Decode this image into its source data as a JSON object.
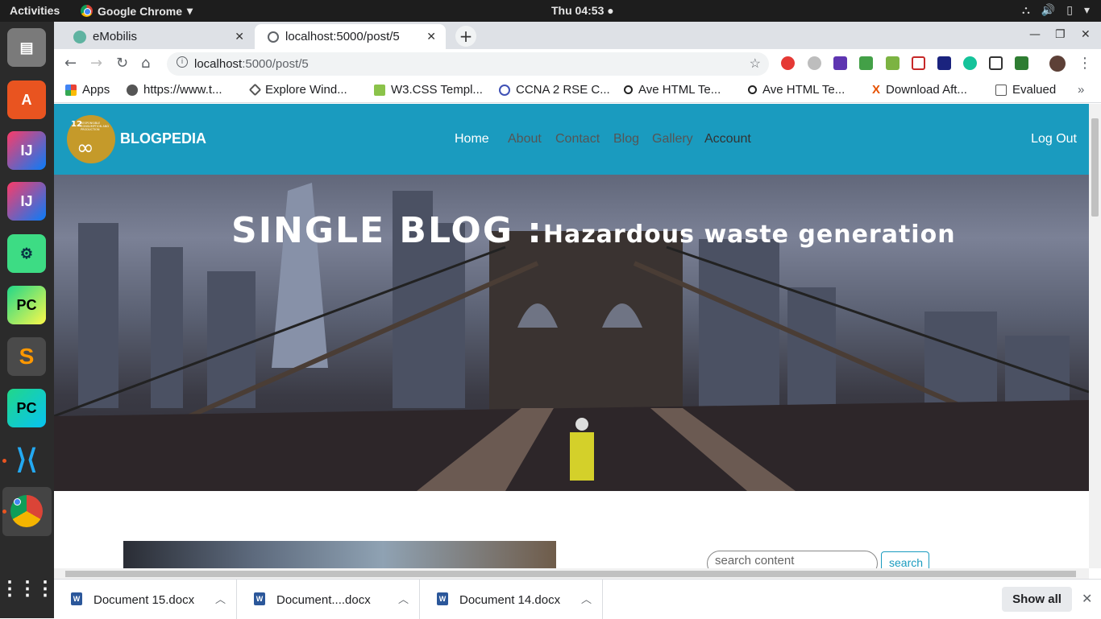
{
  "os": {
    "activities": "Activities",
    "app_name": "Google Chrome",
    "clock": "Thu 04:53 ●"
  },
  "browser": {
    "tabs": [
      {
        "title": "eMobilis"
      },
      {
        "title": "localhost:5000/post/5"
      }
    ],
    "url_host": "localhost",
    "url_path": ":5000/post/5",
    "bookmarks": [
      {
        "label": "Apps"
      },
      {
        "label": "https://www.t..."
      },
      {
        "label": "Explore Wind..."
      },
      {
        "label": "W3.CSS Templ..."
      },
      {
        "label": "CCNA 2 RSE C..."
      },
      {
        "label": "Ave HTML Te..."
      },
      {
        "label": "Ave HTML Te..."
      },
      {
        "label": "Download Aft..."
      },
      {
        "label": "Evalued"
      }
    ]
  },
  "site": {
    "brand": "BLOGPEDIA",
    "logo_number": "12",
    "logo_text": "RESPONSIBLE CONSUMPTION AND PRODUCTION",
    "nav": [
      "Home",
      "About",
      "Contact",
      "Blog",
      "Gallery",
      "Account"
    ],
    "logout": "Log Out",
    "hero_title": "SINGLE BLOG :",
    "hero_subtitle": "Hazardous waste generation",
    "search_placeholder": "search content",
    "search_button": "search"
  },
  "downloads": {
    "files": [
      "Document 15.docx",
      "Document....docx",
      "Document 14.docx"
    ],
    "show_all": "Show all"
  },
  "colors": {
    "nav_bg": "#1a9bbf",
    "logo_bg": "#c59a2a"
  }
}
